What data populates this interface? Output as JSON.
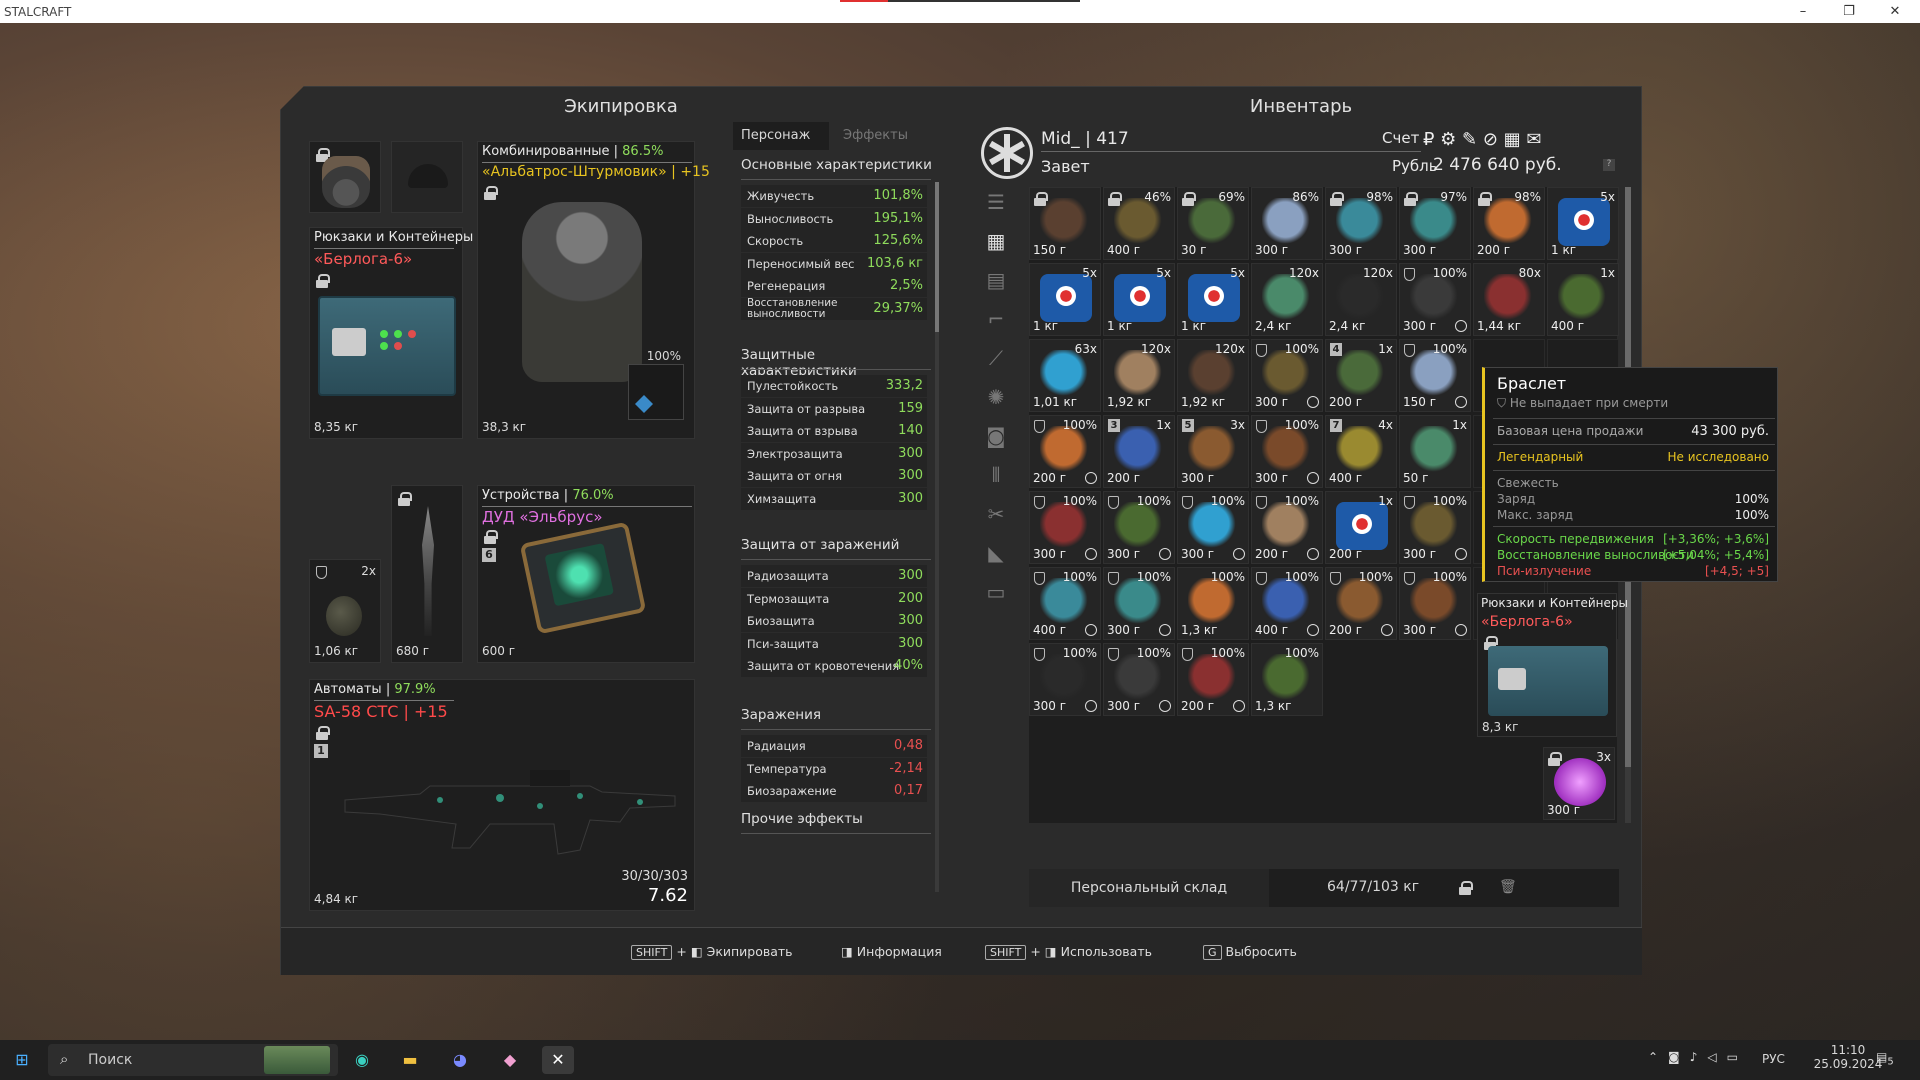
{
  "window": {
    "title": "STALCRAFT"
  },
  "equip": {
    "title": "Экипировка",
    "backpack": {
      "header": "Рюкзаки и Контейнеры",
      "name": "«Берлога-6»",
      "weight": "8,35 кг"
    },
    "armor": {
      "header": "Комбинированные",
      "pct": "86.5%",
      "name": "«Альбатрос-Штурмовик» | +15",
      "weight": "38,3 кг",
      "artpct": "100%"
    },
    "knife": {
      "weight": "680 г"
    },
    "grenade": {
      "count": "2x",
      "weight": "1,06 кг"
    },
    "device": {
      "header": "Устройства",
      "pct": "76.0%",
      "name": "ДУД «Эльбрус»",
      "badge": "6",
      "weight": "600 г"
    },
    "weapon": {
      "header": "Автоматы",
      "pct": "97.9%",
      "name": "SA-58 СТС | +15",
      "badge": "1",
      "weight": "4,84 кг",
      "ammo": "30/30/303",
      "caliber": "7.62"
    }
  },
  "tabs": {
    "character": "Персонаж",
    "effects": "Эффекты"
  },
  "stats": {
    "basic_title": "Основные характеристики",
    "basic": [
      {
        "n": "Живучесть",
        "v": "101,8%"
      },
      {
        "n": "Выносливость",
        "v": "195,1%"
      },
      {
        "n": "Скорость",
        "v": "125,6%"
      },
      {
        "n": "Переносимый вес",
        "v": "103,6 кг"
      },
      {
        "n": "Регенерация",
        "v": "2,5%"
      },
      {
        "n": "Восстановление выносливости",
        "v": "29,37%"
      }
    ],
    "def_title": "Защитные характеристики",
    "def": [
      {
        "n": "Пулестойкость",
        "v": "333,2"
      },
      {
        "n": "Защита от разрыва",
        "v": "159"
      },
      {
        "n": "Защита от взрыва",
        "v": "140"
      },
      {
        "n": "Электрозащита",
        "v": "300"
      },
      {
        "n": "Защита от огня",
        "v": "300"
      },
      {
        "n": "Химзащита",
        "v": "300"
      }
    ],
    "inf_title": "Защита от заражений",
    "inf": [
      {
        "n": "Радиозащита",
        "v": "300"
      },
      {
        "n": "Термозащита",
        "v": "200"
      },
      {
        "n": "Биозащита",
        "v": "300"
      },
      {
        "n": "Пси-защита",
        "v": "300"
      },
      {
        "n": "Защита от кровотечения",
        "v": "40%"
      }
    ],
    "cont_title": "Заражения",
    "cont": [
      {
        "n": "Радиация",
        "v": "0,48"
      },
      {
        "n": "Температура",
        "v": "-2,14"
      },
      {
        "n": "Биозаражение",
        "v": "0,17"
      }
    ],
    "other_title": "Прочие эффекты"
  },
  "inv": {
    "title": "Инвентарь",
    "player": "Mid_ | 417",
    "clan": "Завет",
    "account_label": "Счет",
    "currency_label": "Рубль",
    "money": "2 476 640 руб.",
    "storage": "Персональный склад",
    "weight": "64/77/103 кг",
    "bp_header": "Рюкзаки и Контейнеры",
    "bp_name": "«Берлога-6»",
    "bp_weight": "8,3 кг",
    "chain_count": "3x",
    "chain_weight": "300 г"
  },
  "items": [
    [
      "",
      "150 г",
      "lock"
    ],
    [
      "46%",
      "400 г",
      "lock"
    ],
    [
      "69%",
      "30 г",
      "lock"
    ],
    [
      "86%",
      "300 г",
      ""
    ],
    [
      "98%",
      "300 г",
      "lock"
    ],
    [
      "97%",
      "300 г",
      "lock"
    ],
    [
      "98%",
      "200 г",
      "lock"
    ],
    [
      "5x",
      "1 кг",
      "med"
    ],
    [
      "5x",
      "1 кг",
      "med"
    ],
    [
      "5x",
      "1 кг",
      "med"
    ],
    [
      "5x",
      "1 кг",
      "med"
    ],
    [
      "120x",
      "2,4 кг",
      ""
    ],
    [
      "120x",
      "2,4 кг",
      ""
    ],
    [
      "100%",
      "300 г",
      "shc"
    ],
    [
      "80x",
      "1,44 кг",
      ""
    ],
    [
      "1x",
      "400 г",
      ""
    ],
    [
      "63x",
      "1,01 кг",
      ""
    ],
    [
      "120x",
      "1,92 кг",
      ""
    ],
    [
      "120x",
      "1,92 кг",
      ""
    ],
    [
      "100%",
      "300 г",
      "shc"
    ],
    [
      "1x",
      "200 г",
      "n4"
    ],
    [
      "100%",
      "150 г",
      "shc"
    ],
    [
      "",
      "",
      " "
    ],
    [
      "",
      "",
      " "
    ],
    [
      "100%",
      "200 г",
      "shc"
    ],
    [
      "1x",
      "200 г",
      "n3"
    ],
    [
      "3x",
      "300 г",
      "n5"
    ],
    [
      "100%",
      "300 г",
      "shc"
    ],
    [
      "4x",
      "400 г",
      "n7"
    ],
    [
      "1x",
      "50 г",
      ""
    ],
    [
      "",
      "",
      " "
    ],
    [
      "",
      "",
      " "
    ],
    [
      "100%",
      "300 г",
      "shc"
    ],
    [
      "100%",
      "300 г",
      "shc"
    ],
    [
      "100%",
      "300 г",
      "shc"
    ],
    [
      "100%",
      "200 г",
      "shc"
    ],
    [
      "1x",
      "200 г",
      "med"
    ],
    [
      "100%",
      "300 г",
      "shc"
    ],
    [
      "",
      "",
      " "
    ],
    [
      "",
      "",
      " "
    ],
    [
      "100%",
      "400 г",
      "shc"
    ],
    [
      "100%",
      "300 г",
      "shc"
    ],
    [
      "100%",
      "1,3 кг",
      "c"
    ],
    [
      "100%",
      "400 г",
      "shc"
    ],
    [
      "100%",
      "200 г",
      "shc"
    ],
    [
      "100%",
      "300 г",
      "shc"
    ],
    [
      "",
      "",
      " "
    ],
    [
      "",
      "",
      " "
    ],
    [
      "100%",
      "300 г",
      "shc"
    ],
    [
      "100%",
      "300 г",
      "shc"
    ],
    [
      "100%",
      "200 г",
      "shc"
    ],
    [
      "100%",
      "1,3 кг",
      ""
    ]
  ],
  "tooltip": {
    "name": "Браслет",
    "nodrop": "Не выпадает при смерти",
    "price_label": "Базовая цена продажи",
    "price": "43 300 руб.",
    "rarity": "Легендарный",
    "status": "Не исследовано",
    "fresh": "Свежесть",
    "charge": "Заряд",
    "charge_v": "100%",
    "maxcharge": "Макс. заряд",
    "maxcharge_v": "100%",
    "b1": "Скорость передвижения",
    "b1v": "[+3,36%; +3,6%]",
    "b2": "Восстановление выносливости",
    "b2v": "[+5,04%; +5,4%]",
    "b3": "Пси-излучение",
    "b3v": "[+4,5; +5]"
  },
  "footer": {
    "k1": "SHIFT",
    "a1": "Экипировать",
    "a2": "Информация",
    "k3": "SHIFT",
    "a3": "Использовать",
    "k4": "G",
    "a4": "Выбросить"
  },
  "taskbar": {
    "search": "Поиск",
    "lang": "РУС",
    "time": "11:10",
    "date": "25.09.2024",
    "notif": "5"
  },
  "colors": {
    "green": "#8fdc5c",
    "red": "#e85050",
    "pink": "#e070e0",
    "gold": "#e8c420"
  }
}
